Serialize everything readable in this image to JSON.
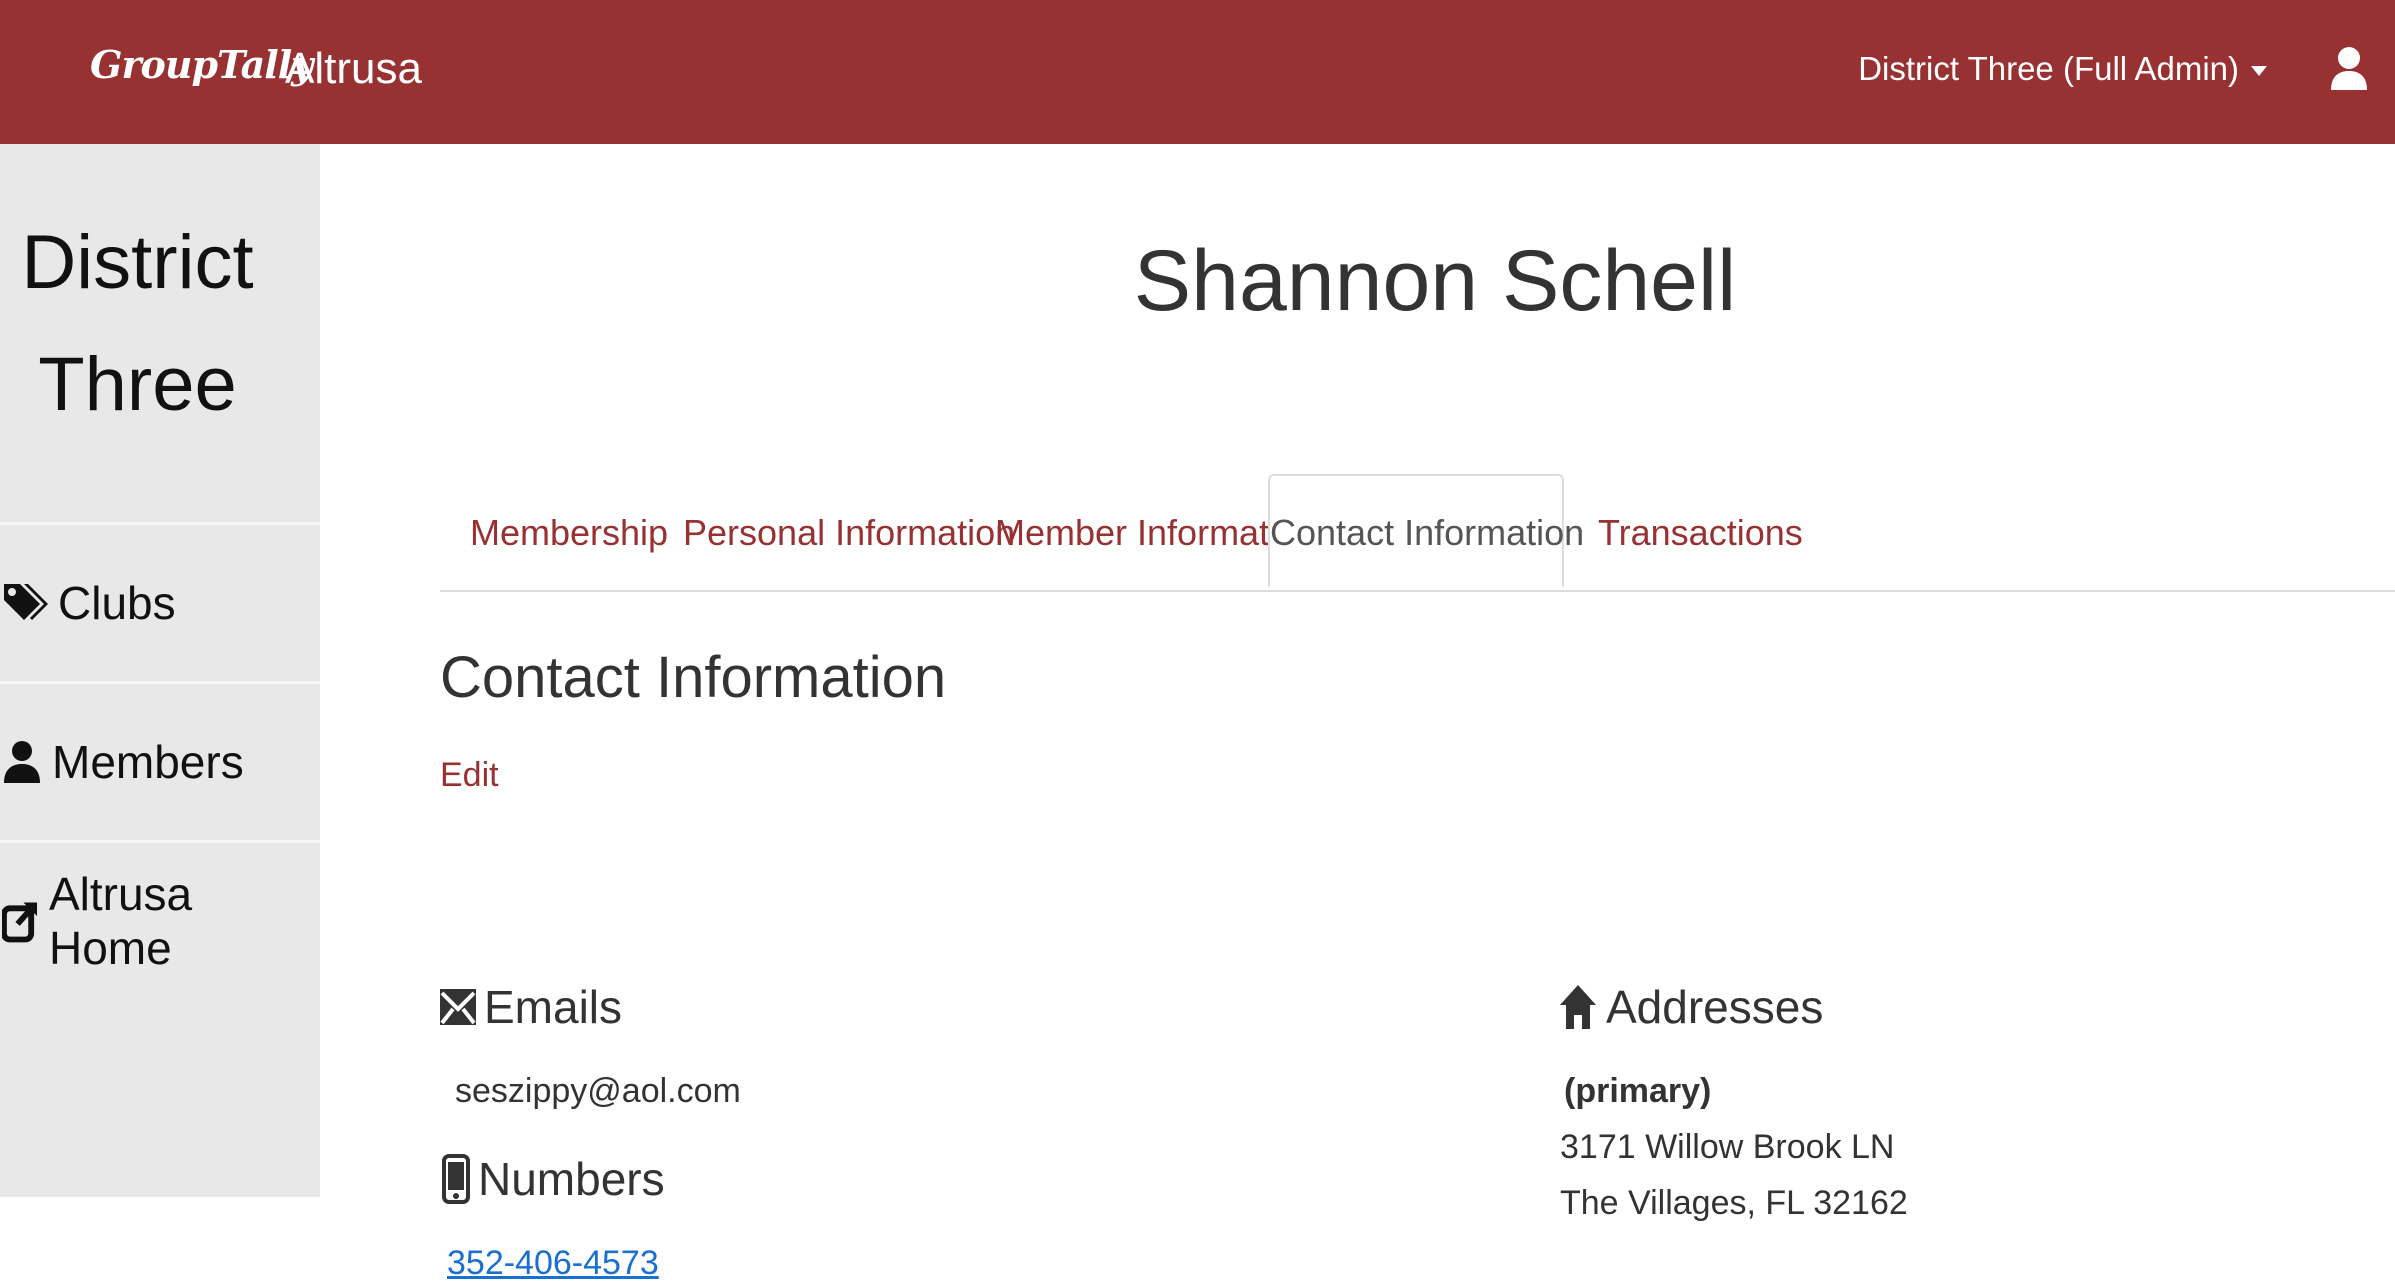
{
  "header": {
    "brand": "GroupTally",
    "org_name": "Altrusa",
    "account_label": "District Three (Full Admin)"
  },
  "sidebar": {
    "title_line1": "District",
    "title_line2": "Three",
    "items": [
      {
        "label": "Clubs",
        "icon": "tags-icon"
      },
      {
        "label": "Members",
        "icon": "user-icon"
      },
      {
        "label": "Altrusa Home",
        "icon": "external-link-icon"
      }
    ]
  },
  "member": {
    "name": "Shannon Schell"
  },
  "tabs": [
    {
      "label": "Membership",
      "active": false
    },
    {
      "label": "Personal Information",
      "active": false
    },
    {
      "label": "Member Information",
      "active": false
    },
    {
      "label": "Contact Information",
      "active": true
    },
    {
      "label": "Transactions",
      "active": false
    }
  ],
  "contact": {
    "title": "Contact Information",
    "edit_label": "Edit",
    "emails_heading": "Emails",
    "email": "seszippy@aol.com",
    "numbers_heading": "Numbers",
    "phone": "352-406-4573",
    "addresses_heading": "Addresses",
    "address_primary_label": "(primary)",
    "address_line1": "3171 Willow Brook LN",
    "address_line2": "The Villages, FL 32162"
  },
  "colors": {
    "brand": "#973132",
    "link": "#1a6fd1",
    "sidebar_bg": "#e8e8e8"
  }
}
